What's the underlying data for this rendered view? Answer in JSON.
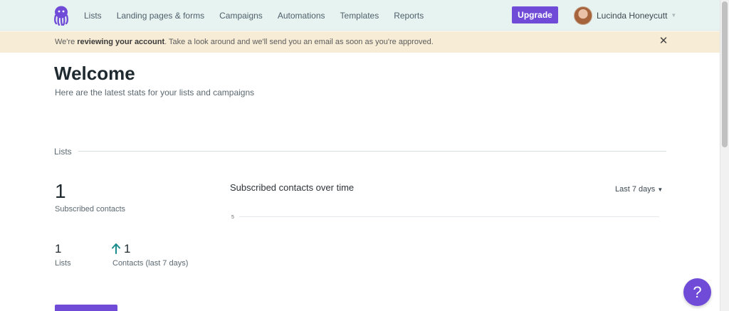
{
  "nav": {
    "links": [
      "Lists",
      "Landing pages & forms",
      "Campaigns",
      "Automations",
      "Templates",
      "Reports"
    ],
    "upgrade_label": "Upgrade",
    "user_name": "Lucinda Honeycutt",
    "caret_icon": "chevron-down-icon"
  },
  "banner": {
    "text_before": "We're ",
    "text_bold": "reviewing your account",
    "text_after": ". Take a look around and we'll send you an email as soon as you're approved.",
    "close_glyph": "✕"
  },
  "main": {
    "title": "Welcome",
    "subtitle": "Here are the latest stats for your lists and campaigns"
  },
  "lists_section": {
    "label": "Lists",
    "subscribed_count": "1",
    "subscribed_label": "Subscribed contacts",
    "lists_count": "1",
    "lists_label": "Lists",
    "contacts_count": "1",
    "contacts_label": "Contacts (last 7 days)"
  },
  "chart_data": {
    "type": "line",
    "title": "Subscribed contacts over time",
    "range_label": "Last 7 days",
    "y_tick_labels": [
      "5"
    ],
    "series": []
  },
  "help": {
    "label": "?"
  },
  "colors": {
    "accent": "#6f4bd8",
    "nav_bg": "#e6f3f1",
    "banner_bg": "#f7ecd5",
    "arrow": "#1a8c8c"
  }
}
